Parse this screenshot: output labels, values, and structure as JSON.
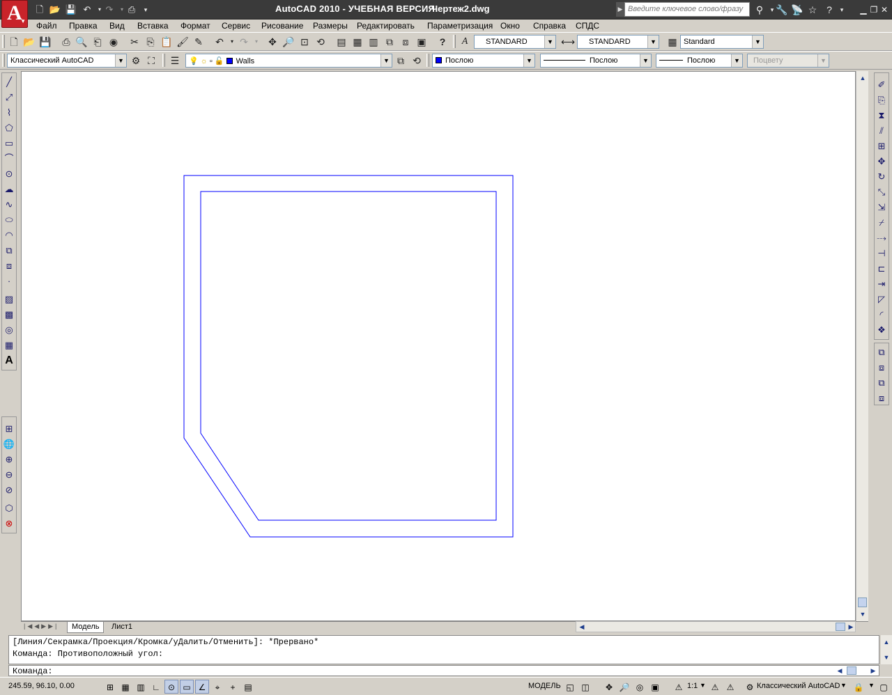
{
  "titlebar": {
    "app_title": "AutoCAD 2010 - УЧЕБНАЯ ВЕРСИЯ",
    "file_name": "Чертеж2.dwg",
    "logo_letter": "A",
    "search_placeholder": "Введите ключевое слово/фразу"
  },
  "menu": [
    "Файл",
    "Правка",
    "Вид",
    "Вставка",
    "Формат",
    "Сервис",
    "Рисование",
    "Размеры",
    "Редактировать",
    "Параметризация",
    "Окно",
    "Справка",
    "СПДС"
  ],
  "styles": {
    "text_style": "STANDARD",
    "dim_style": "STANDARD",
    "table_style": "Standard"
  },
  "workspace": {
    "name": "Классический AutoCAD"
  },
  "layer": {
    "name": "Walls",
    "color": "#0000ff"
  },
  "properties": {
    "color": "Послою",
    "linetype": "Послою",
    "lineweight": "Послою",
    "plotstyle": "Поцвету"
  },
  "drawing": {
    "line_color": "#0000ff"
  },
  "tabs": [
    "Модель",
    "Лист1"
  ],
  "command": {
    "line1": "[Линия/Секрамка/Проекция/Кромка/уДалить/Отменить]: *Прервано*",
    "line2": "Команда: Противоположный угол:",
    "prompt": "Команда:"
  },
  "status": {
    "coordinates": "245.59, 96.10, 0.00",
    "model_label": "МОДЕЛЬ",
    "annotation_scale": "1:1",
    "workspace": "Классический AutoCAD"
  }
}
